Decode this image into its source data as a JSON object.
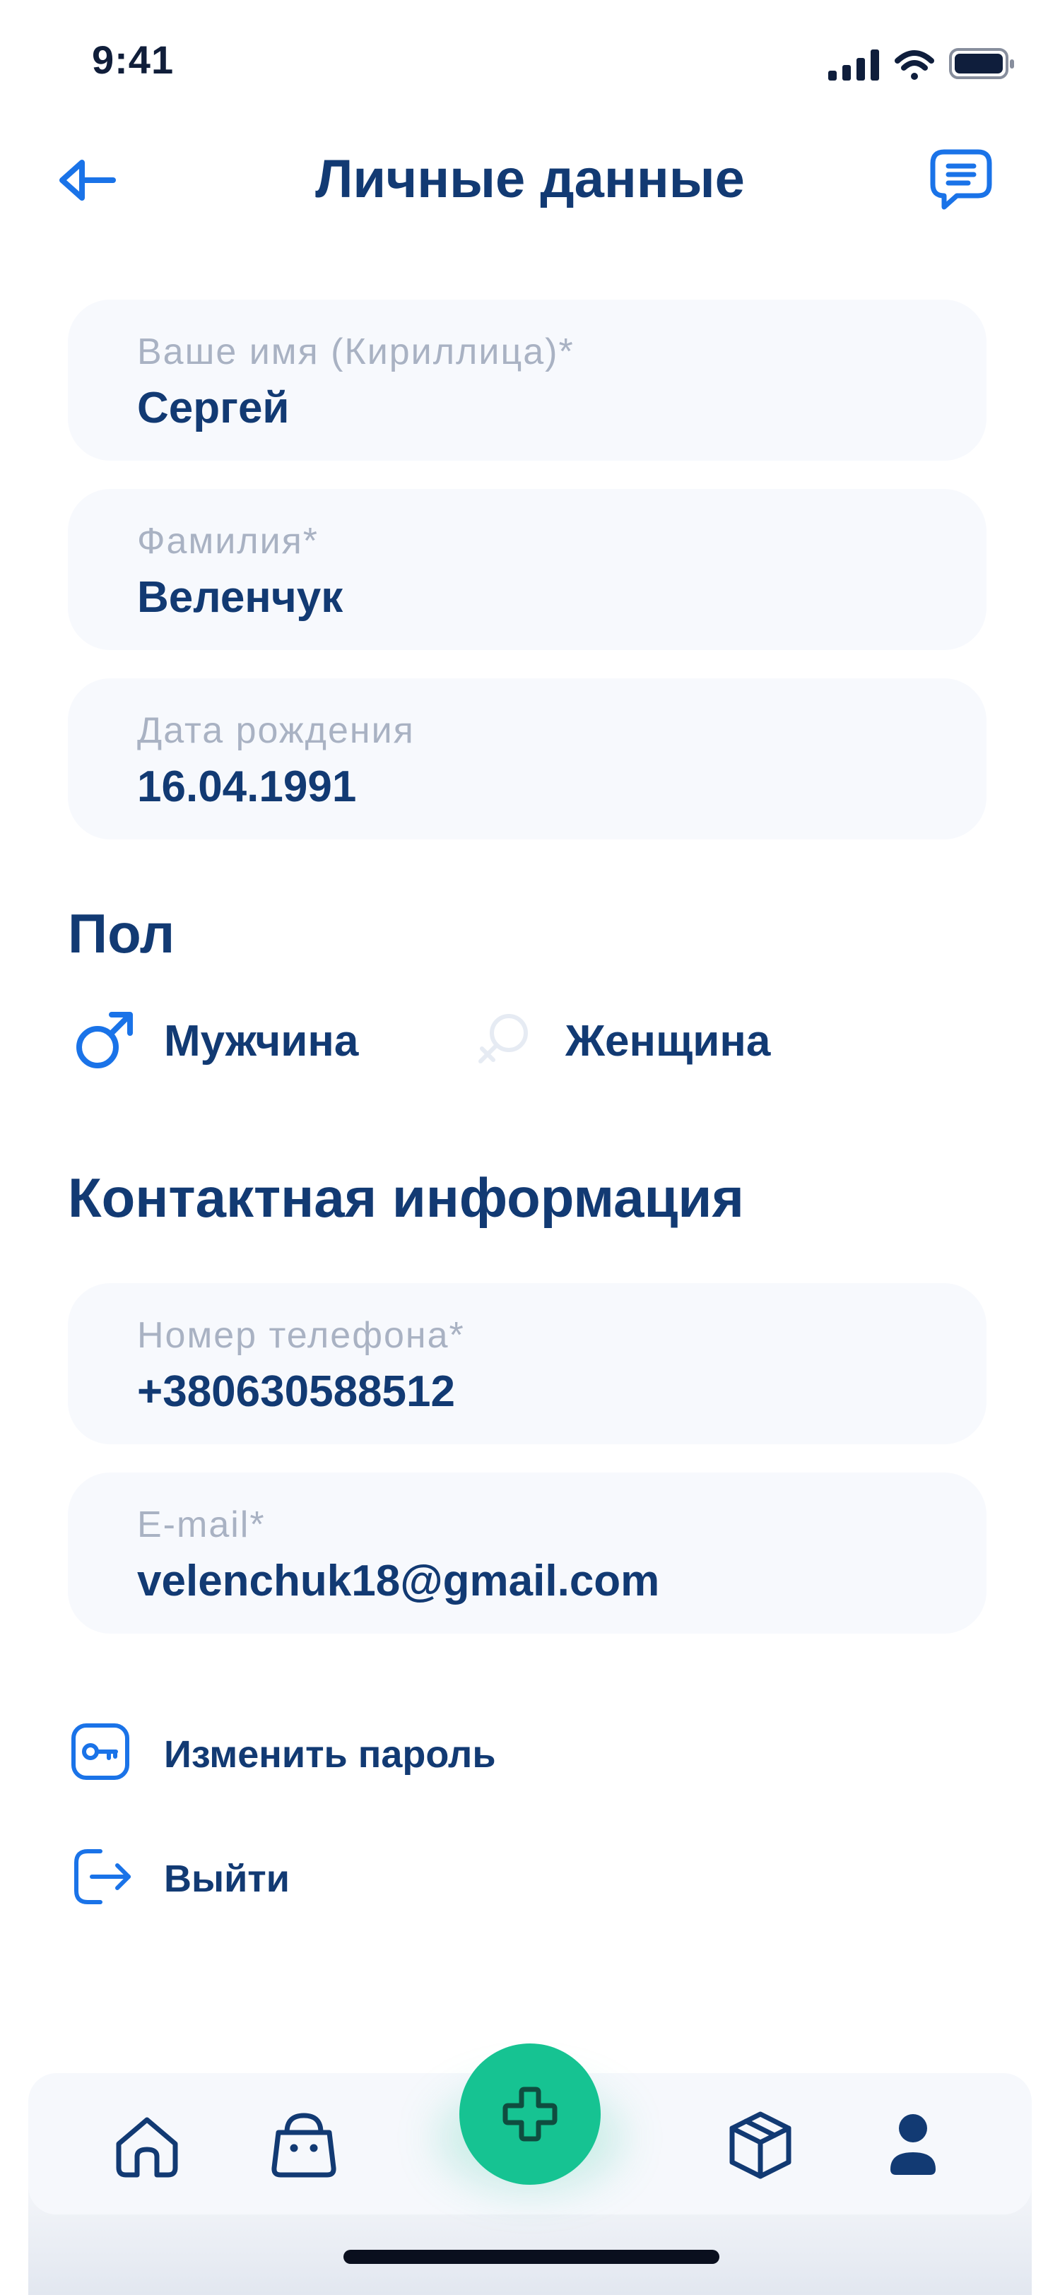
{
  "status_bar": {
    "time": "9:41"
  },
  "header": {
    "title": "Личные данные"
  },
  "fields": {
    "first_name": {
      "label": "Ваше имя (Кириллица)*",
      "value": "Сергей"
    },
    "last_name": {
      "label": "Фамилия*",
      "value": "Веленчук"
    },
    "birth_date": {
      "label": "Дата рождения",
      "value": "16.04.1991"
    },
    "phone": {
      "label": "Номер телефона*",
      "value": "+380630588512"
    },
    "email": {
      "label": "E-mail*",
      "value": "velenchuk18@gmail.com"
    }
  },
  "gender": {
    "title": "Пол",
    "options": [
      {
        "label": "Мужчина",
        "selected": true
      },
      {
        "label": "Женщина",
        "selected": false
      }
    ]
  },
  "contacts": {
    "title": "Контактная информация"
  },
  "actions": {
    "change_password": "Изменить пароль",
    "logout": "Выйти"
  },
  "bottom_nav": {
    "items": [
      "home-icon",
      "bag-icon",
      "plus-icon",
      "box-icon",
      "user-icon"
    ],
    "active": "user-icon"
  },
  "colors": {
    "primary": "#123a73",
    "accent": "#1a73e8",
    "fab": "#16c392",
    "field_bg": "#f7f9fd",
    "label": "#a9b2c3"
  }
}
